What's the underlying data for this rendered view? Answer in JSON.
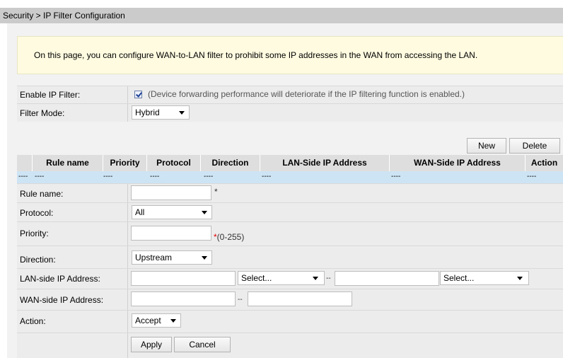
{
  "breadcrumb": "Security > IP Filter Configuration",
  "notice": "On this page, you can configure WAN-to-LAN filter to prohibit some IP addresses in the WAN from accessing the LAN.",
  "enable_filter": {
    "label": "Enable IP Filter:",
    "checked": true,
    "note": "(Device forwarding performance will deteriorate if the IP filtering function is enabled.)"
  },
  "filter_mode": {
    "label": "Filter Mode:",
    "value": "Hybrid"
  },
  "table_buttons": {
    "new": "New",
    "delete": "Delete"
  },
  "table": {
    "columns": [
      "Rule name",
      "Priority",
      "Protocol",
      "Direction",
      "LAN-Side IP Address",
      "WAN-Side IP Address",
      "Action"
    ],
    "rows": [
      [
        "----",
        "----",
        "----",
        "----",
        "----",
        "----",
        "----",
        "----"
      ]
    ]
  },
  "form": {
    "rule_name": {
      "label": "Rule name:",
      "value": "",
      "required": "*"
    },
    "protocol": {
      "label": "Protocol:",
      "value": "All"
    },
    "priority": {
      "label": "Priority:",
      "value": "",
      "required": "*",
      "hint": "(0-255)"
    },
    "direction": {
      "label": "Direction:",
      "value": "Upstream"
    },
    "lan_ip": {
      "label": "LAN-side IP Address:",
      "start_select": "Select...",
      "separator": "--",
      "end_select": "Select..."
    },
    "wan_ip": {
      "label": "WAN-side IP Address:",
      "separator": "--"
    },
    "action": {
      "label": "Action:",
      "value": "Accept"
    }
  },
  "form_buttons": {
    "apply": "Apply",
    "cancel": "Cancel"
  }
}
